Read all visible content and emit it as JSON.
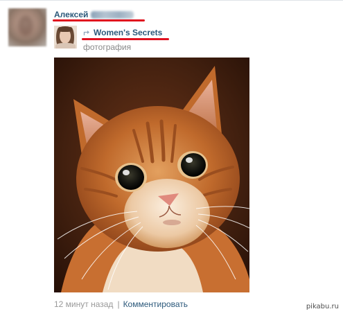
{
  "post": {
    "author": {
      "first_name": "Алексей",
      "avatar_icon": "user-avatar-blurred"
    },
    "repost": {
      "icon": "repost-arrow-icon",
      "source_name": "Women's Secrets",
      "source_avatar_icon": "group-avatar-woman",
      "attachment_type": "фотография"
    },
    "photo": {
      "subject": "ginger-cat-photo"
    },
    "footer": {
      "timestamp": "12 минут назад",
      "separator": "|",
      "comment_label": "Комментировать"
    }
  },
  "watermark": "pikabu.ru",
  "colors": {
    "link_blue": "#2b587a",
    "meta_gray": "#888888",
    "highlight_red": "#e0101e"
  }
}
